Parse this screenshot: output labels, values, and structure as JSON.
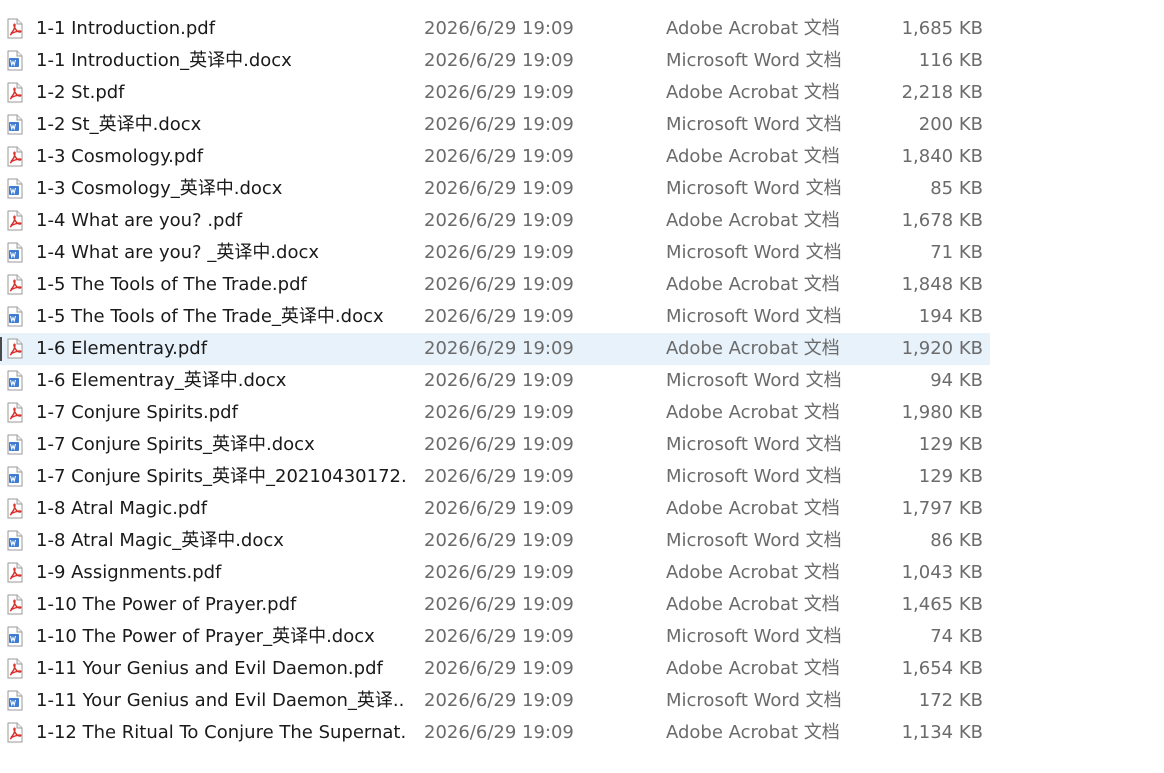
{
  "colors": {
    "pdf_icon": "#d9302c",
    "word_icon": "#3f7bd4",
    "selection": "#e8f2fb",
    "name_text": "#1a1a1a",
    "meta_text": "#6b6b6b"
  },
  "files": [
    {
      "name": "1-1 Introduction.pdf",
      "date": "2026/6/29 19:09",
      "type": "Adobe Acrobat 文档",
      "size": "1,685 KB",
      "icon": "pdf-icon",
      "selected": false
    },
    {
      "name": "1-1 Introduction_英译中.docx",
      "date": "2026/6/29 19:09",
      "type": "Microsoft Word 文档",
      "size": "116 KB",
      "icon": "word-doc-icon",
      "selected": false
    },
    {
      "name": "1-2 St.pdf",
      "date": "2026/6/29 19:09",
      "type": "Adobe Acrobat 文档",
      "size": "2,218 KB",
      "icon": "pdf-icon",
      "selected": false
    },
    {
      "name": "1-2 St_英译中.docx",
      "date": "2026/6/29 19:09",
      "type": "Microsoft Word 文档",
      "size": "200 KB",
      "icon": "word-doc-icon",
      "selected": false
    },
    {
      "name": "1-3 Cosmology.pdf",
      "date": "2026/6/29 19:09",
      "type": "Adobe Acrobat 文档",
      "size": "1,840 KB",
      "icon": "pdf-icon",
      "selected": false
    },
    {
      "name": "1-3 Cosmology_英译中.docx",
      "date": "2026/6/29 19:09",
      "type": "Microsoft Word 文档",
      "size": "85 KB",
      "icon": "word-doc-icon",
      "selected": false
    },
    {
      "name": "1-4 What are you? .pdf",
      "date": "2026/6/29 19:09",
      "type": "Adobe Acrobat 文档",
      "size": "1,678 KB",
      "icon": "pdf-icon",
      "selected": false
    },
    {
      "name": "1-4 What are you? _英译中.docx",
      "date": "2026/6/29 19:09",
      "type": "Microsoft Word 文档",
      "size": "71 KB",
      "icon": "word-doc-icon",
      "selected": false
    },
    {
      "name": "1-5 The Tools of The Trade.pdf",
      "date": "2026/6/29 19:09",
      "type": "Adobe Acrobat 文档",
      "size": "1,848 KB",
      "icon": "pdf-icon",
      "selected": false
    },
    {
      "name": "1-5 The Tools of The Trade_英译中.docx",
      "date": "2026/6/29 19:09",
      "type": "Microsoft Word 文档",
      "size": "194 KB",
      "icon": "word-doc-icon",
      "selected": false
    },
    {
      "name": "1-6 Elementray.pdf",
      "date": "2026/6/29 19:09",
      "type": "Adobe Acrobat 文档",
      "size": "1,920 KB",
      "icon": "pdf-icon",
      "selected": true
    },
    {
      "name": "1-6 Elementray_英译中.docx",
      "date": "2026/6/29 19:09",
      "type": "Microsoft Word 文档",
      "size": "94 KB",
      "icon": "word-doc-icon",
      "selected": false
    },
    {
      "name": "1-7 Conjure Spirits.pdf",
      "date": "2026/6/29 19:09",
      "type": "Adobe Acrobat 文档",
      "size": "1,980 KB",
      "icon": "pdf-icon",
      "selected": false
    },
    {
      "name": "1-7 Conjure Spirits_英译中.docx",
      "date": "2026/6/29 19:09",
      "type": "Microsoft Word 文档",
      "size": "129 KB",
      "icon": "word-doc-icon",
      "selected": false
    },
    {
      "name": "1-7 Conjure Spirits_英译中_20210430172...",
      "date": "2026/6/29 19:09",
      "type": "Microsoft Word 文档",
      "size": "129 KB",
      "icon": "word-doc-icon",
      "selected": false
    },
    {
      "name": "1-8 Atral Magic.pdf",
      "date": "2026/6/29 19:09",
      "type": "Adobe Acrobat 文档",
      "size": "1,797 KB",
      "icon": "pdf-icon",
      "selected": false
    },
    {
      "name": "1-8 Atral Magic_英译中.docx",
      "date": "2026/6/29 19:09",
      "type": "Microsoft Word 文档",
      "size": "86 KB",
      "icon": "word-doc-icon",
      "selected": false
    },
    {
      "name": "1-9 Assignments.pdf",
      "date": "2026/6/29 19:09",
      "type": "Adobe Acrobat 文档",
      "size": "1,043 KB",
      "icon": "pdf-icon",
      "selected": false
    },
    {
      "name": "1-10 The Power of Prayer.pdf",
      "date": "2026/6/29 19:09",
      "type": "Adobe Acrobat 文档",
      "size": "1,465 KB",
      "icon": "pdf-icon",
      "selected": false
    },
    {
      "name": "1-10 The Power of Prayer_英译中.docx",
      "date": "2026/6/29 19:09",
      "type": "Microsoft Word 文档",
      "size": "74 KB",
      "icon": "word-doc-icon",
      "selected": false
    },
    {
      "name": "1-11 Your Genius and Evil Daemon.pdf",
      "date": "2026/6/29 19:09",
      "type": "Adobe Acrobat 文档",
      "size": "1,654 KB",
      "icon": "pdf-icon",
      "selected": false
    },
    {
      "name": "1-11 Your Genius and Evil Daemon_英译...",
      "date": "2026/6/29 19:09",
      "type": "Microsoft Word 文档",
      "size": "172 KB",
      "icon": "word-doc-icon",
      "selected": false
    },
    {
      "name": "1-12 The Ritual To Conjure The Supernat...",
      "date": "2026/6/29 19:09",
      "type": "Adobe Acrobat 文档",
      "size": "1,134 KB",
      "icon": "pdf-icon",
      "selected": false
    }
  ]
}
